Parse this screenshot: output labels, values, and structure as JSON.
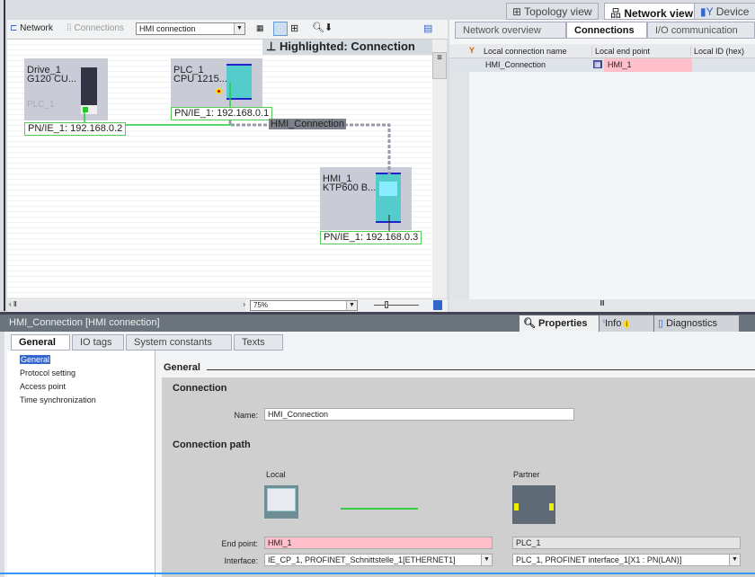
{
  "view_tabs": [
    "Topology view",
    "Network view",
    "Device"
  ],
  "toolbar": {
    "network": "Network",
    "connections": "Connections",
    "connection_type": "HMI connection"
  },
  "canvas": {
    "highlight": "Highlighted: Connection",
    "devices": [
      {
        "name": "Drive_1",
        "type": "G120 CU...",
        "sub": "PLC_1",
        "ip": "PN/IE_1:  192.168.0.2"
      },
      {
        "name": "PLC_1",
        "type": "CPU 1215...",
        "ip": "PN/IE_1:  192.168.0.1"
      },
      {
        "name": "HMI_1",
        "type": "KTP600 B...",
        "ip": "PN/IE_1:  192.168.0.3"
      }
    ],
    "connection_label": "HMI_Connection",
    "zoom": "75%"
  },
  "right_pane": {
    "tabs": [
      "Network overview",
      "Connections",
      "I/O communication"
    ],
    "columns": [
      "Local connection name",
      "Local end point",
      "Local ID (hex)"
    ],
    "rows": [
      {
        "name": "HMI_Connection",
        "end_point": "HMI_1",
        "id": ""
      }
    ]
  },
  "properties": {
    "title": "HMI_Connection [HMI connection]",
    "panel_tabs": [
      "Properties",
      "Info",
      "Diagnostics"
    ],
    "tabs": [
      "General",
      "IO tags",
      "System constants",
      "Texts"
    ],
    "nav": [
      "General",
      "Protocol setting",
      "Access point",
      "Time synchronization"
    ],
    "section": "General",
    "connection_header": "Connection",
    "name_label": "Name:",
    "name_value": "HMI_Connection",
    "path_header": "Connection path",
    "local": "Local",
    "partner": "Partner",
    "end_point_label": "End point:",
    "local_end_point": "HMI_1",
    "partner_end_point": "PLC_1",
    "interface_label": "Interface:",
    "local_interface": "IE_CP_1, PROFINET_Schnittstelle_1[ETHERNET1]",
    "partner_interface": "PLC_1, PROFINET interface_1[X1 : PN(LAN)]"
  },
  "colors": {
    "accent_pink": "#ffc0cb",
    "link_green": "#33cc44",
    "header_gray": "#6b747c"
  }
}
